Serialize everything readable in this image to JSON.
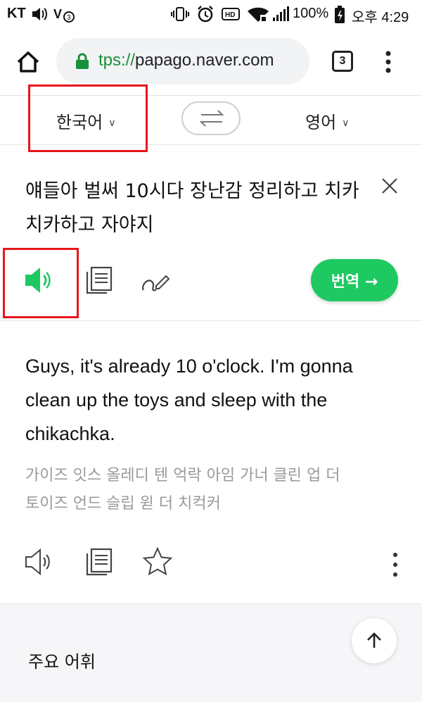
{
  "status_bar": {
    "carrier": "KT",
    "battery": "100%",
    "time": "오후 4:29"
  },
  "browser": {
    "url_scheme": "tps://",
    "url_host": "papago.naver.com",
    "tab_count": "3"
  },
  "languages": {
    "source": "한국어",
    "target": "영어"
  },
  "source": {
    "text": "얘들아 벌써 10시다 장난감 정리하고 치카치카하고 자야지"
  },
  "actions": {
    "translate_label": "번역 →"
  },
  "result": {
    "text": "Guys, it's already 10 o'clock. I'm gonna clean up the toys and sleep with the chikachka.",
    "pronunciation": "가이즈 잇스 올레디 텐 억락 아임 가너 클린 업 더 토이즈 언드 슬립 윋 더 치컥커"
  },
  "vocab": {
    "title": "주요 어휘"
  },
  "colors": {
    "accent_green": "#1ec961",
    "highlight_red": "#e8151c"
  },
  "icons": [
    "home-icon",
    "lock-icon",
    "tab-count-icon",
    "menu-dots-icon",
    "swap-icon",
    "close-icon",
    "speaker-icon",
    "copy-icon",
    "handwriting-icon",
    "star-icon",
    "more-vertical-icon",
    "arrow-up-icon"
  ]
}
